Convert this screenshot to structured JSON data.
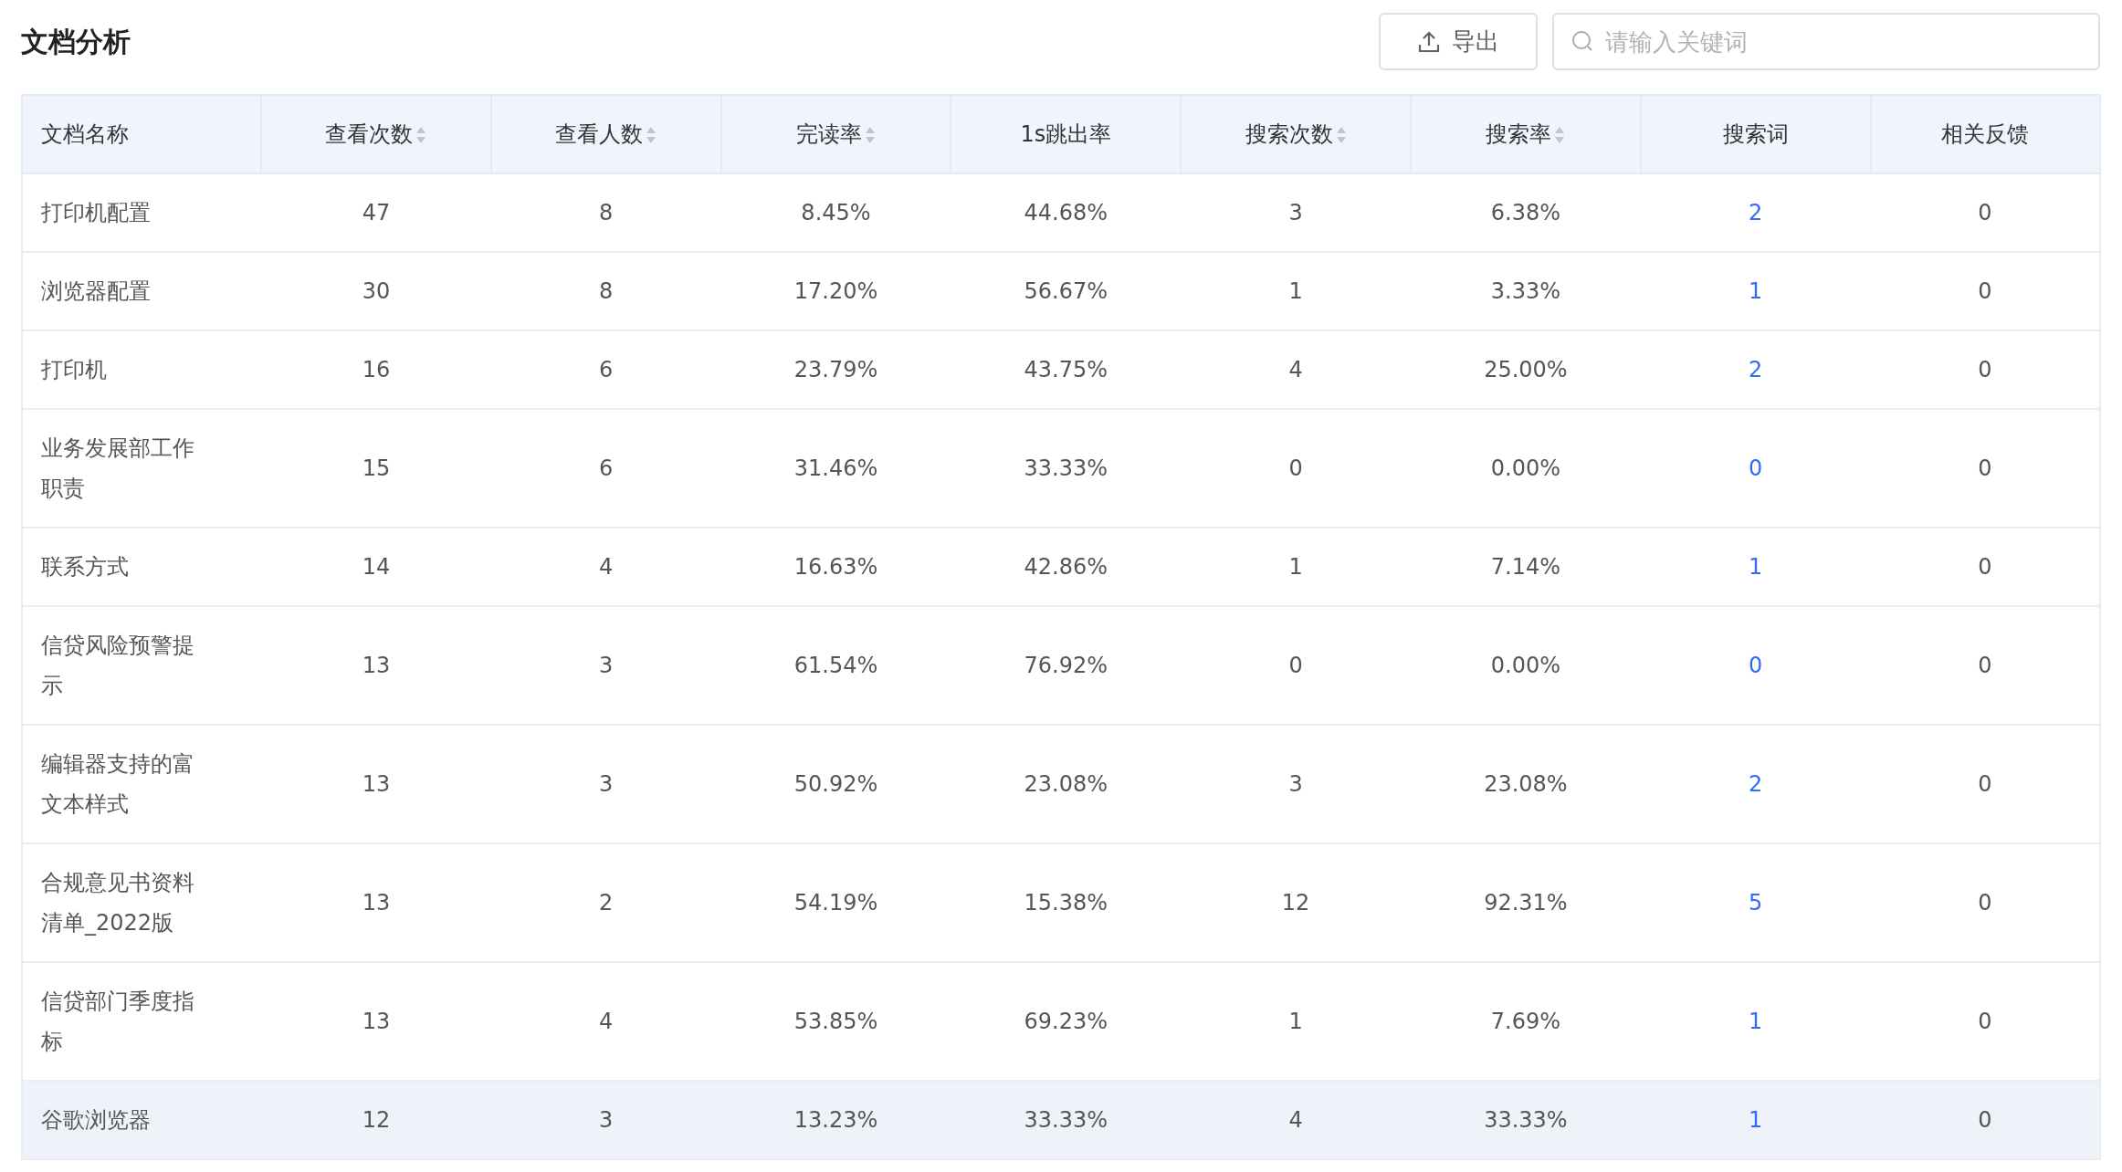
{
  "page_title": "文档分析",
  "export_button": {
    "label": "导出"
  },
  "search": {
    "placeholder": "请输入关键词"
  },
  "table": {
    "columns": [
      {
        "label": "文档名称",
        "sortable": false,
        "kind": "text"
      },
      {
        "label": "查看次数",
        "sortable": true,
        "kind": "text"
      },
      {
        "label": "查看人数",
        "sortable": true,
        "kind": "text"
      },
      {
        "label": "完读率",
        "sortable": true,
        "kind": "text"
      },
      {
        "label": "1s跳出率",
        "sortable": false,
        "kind": "text"
      },
      {
        "label": "搜索次数",
        "sortable": true,
        "kind": "text"
      },
      {
        "label": "搜索率",
        "sortable": true,
        "kind": "text"
      },
      {
        "label": "搜索词",
        "sortable": false,
        "kind": "link"
      },
      {
        "label": "相关反馈",
        "sortable": false,
        "kind": "text"
      }
    ],
    "rows": [
      {
        "highlighted": false,
        "cells": [
          "打印机配置",
          "47",
          "8",
          "8.45%",
          "44.68%",
          "3",
          "6.38%",
          "2",
          "0"
        ]
      },
      {
        "highlighted": false,
        "cells": [
          "浏览器配置",
          "30",
          "8",
          "17.20%",
          "56.67%",
          "1",
          "3.33%",
          "1",
          "0"
        ]
      },
      {
        "highlighted": false,
        "cells": [
          "打印机",
          "16",
          "6",
          "23.79%",
          "43.75%",
          "4",
          "25.00%",
          "2",
          "0"
        ]
      },
      {
        "highlighted": false,
        "cells": [
          "业务发展部工作职责",
          "15",
          "6",
          "31.46%",
          "33.33%",
          "0",
          "0.00%",
          "0",
          "0"
        ]
      },
      {
        "highlighted": false,
        "cells": [
          "联系方式",
          "14",
          "4",
          "16.63%",
          "42.86%",
          "1",
          "7.14%",
          "1",
          "0"
        ]
      },
      {
        "highlighted": false,
        "cells": [
          "信贷风险预警提示",
          "13",
          "3",
          "61.54%",
          "76.92%",
          "0",
          "0.00%",
          "0",
          "0"
        ]
      },
      {
        "highlighted": false,
        "cells": [
          "编辑器支持的富文本样式",
          "13",
          "3",
          "50.92%",
          "23.08%",
          "3",
          "23.08%",
          "2",
          "0"
        ]
      },
      {
        "highlighted": false,
        "cells": [
          "合规意见书资料清单_2022版",
          "13",
          "2",
          "54.19%",
          "15.38%",
          "12",
          "92.31%",
          "5",
          "0"
        ]
      },
      {
        "highlighted": false,
        "cells": [
          "信贷部门季度指标",
          "13",
          "4",
          "53.85%",
          "69.23%",
          "1",
          "7.69%",
          "1",
          "0"
        ]
      },
      {
        "highlighted": true,
        "cells": [
          "谷歌浏览器",
          "12",
          "3",
          "13.23%",
          "33.33%",
          "4",
          "33.33%",
          "1",
          "0"
        ]
      }
    ]
  }
}
